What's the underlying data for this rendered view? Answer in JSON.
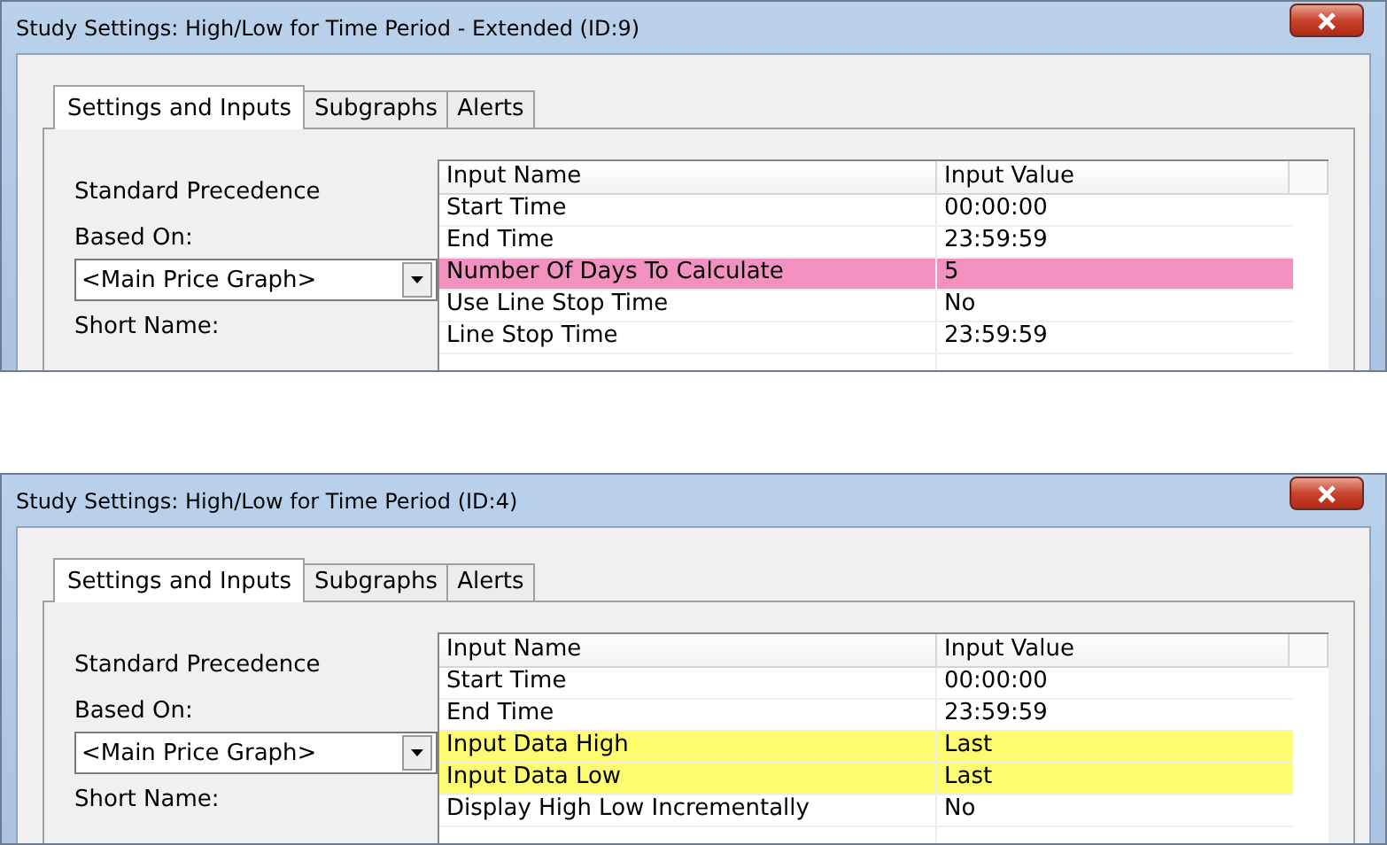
{
  "dialogs": [
    {
      "title": "Study Settings: High/Low for Time Period - Extended (ID:9)",
      "tabs": [
        {
          "label": "Settings and Inputs",
          "selected": true
        },
        {
          "label": "Subgraphs",
          "selected": false
        },
        {
          "label": "Alerts",
          "selected": false
        }
      ],
      "left": {
        "precedence": "Standard Precedence",
        "based_on_label": "Based On:",
        "based_on_value": "<Main Price Graph>",
        "short_name_label": "Short Name:"
      },
      "table": {
        "columns": [
          "Input Name",
          "Input Value"
        ],
        "rows": [
          {
            "name": "Start Time",
            "value": "00:00:00"
          },
          {
            "name": "End Time",
            "value": "23:59:59"
          },
          {
            "name": "Number Of Days To Calculate",
            "value": "5",
            "color": "#f290bf"
          },
          {
            "name": "Use Line Stop Time",
            "value": "No"
          },
          {
            "name": "Line Stop Time",
            "value": "23:59:59"
          }
        ]
      }
    },
    {
      "title": "Study Settings: High/Low for Time Period (ID:4)",
      "tabs": [
        {
          "label": "Settings and Inputs",
          "selected": true
        },
        {
          "label": "Subgraphs",
          "selected": false
        },
        {
          "label": "Alerts",
          "selected": false
        }
      ],
      "left": {
        "precedence": "Standard Precedence",
        "based_on_label": "Based On:",
        "based_on_value": "<Main Price Graph>",
        "short_name_label": "Short Name:"
      },
      "table": {
        "columns": [
          "Input Name",
          "Input Value"
        ],
        "rows": [
          {
            "name": "Start Time",
            "value": "00:00:00"
          },
          {
            "name": "End Time",
            "value": "23:59:59"
          },
          {
            "name": "Input Data High",
            "value": "Last",
            "color": "#fdfc70"
          },
          {
            "name": "Input Data Low",
            "value": "Last",
            "color": "#fdfc70"
          },
          {
            "name": "Display High Low Incrementally",
            "value": "No"
          }
        ]
      }
    }
  ]
}
